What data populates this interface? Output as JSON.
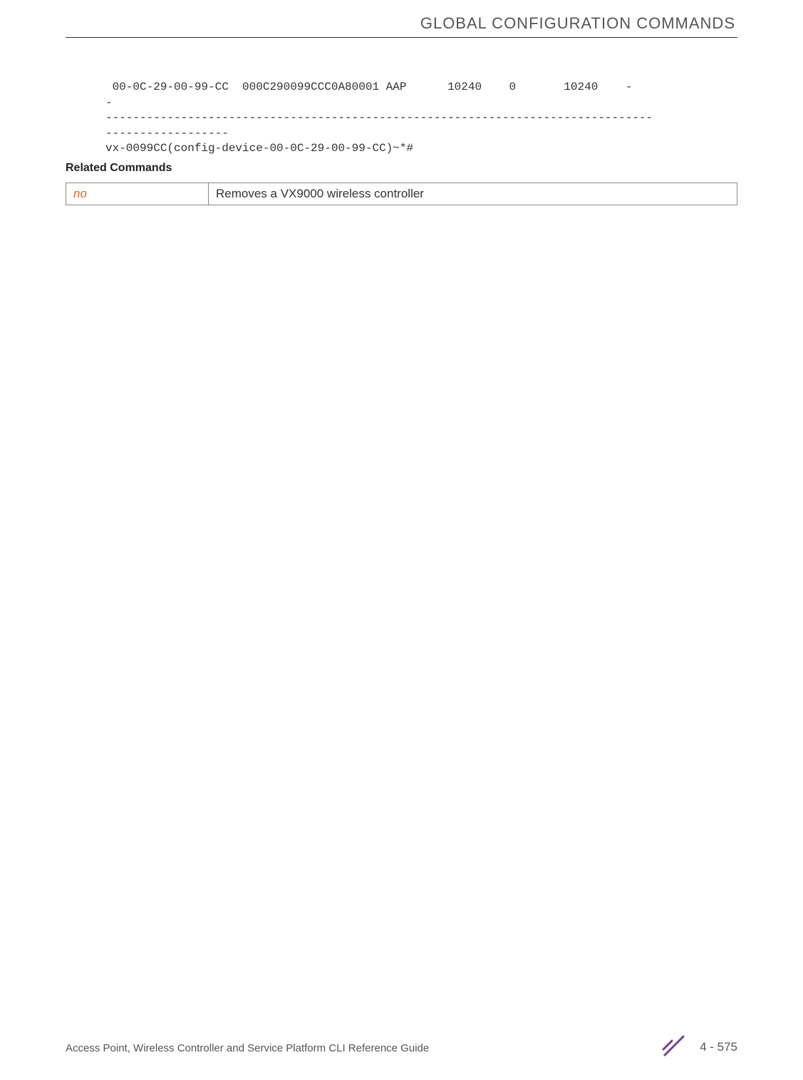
{
  "header": {
    "title": "GLOBAL CONFIGURATION COMMANDS"
  },
  "code": {
    "text": " 00-0C-29-00-99-CC  000C290099CCC0A80001 AAP      10240    0       10240    -       \n-\n--------------------------------------------------------------------------------\n------------------\nvx-0099CC(config-device-00-0C-29-00-99-CC)~*#"
  },
  "related": {
    "heading": "Related Commands",
    "table": {
      "rows": [
        {
          "command": "no",
          "description": "Removes a VX9000 wireless controller"
        }
      ]
    }
  },
  "footer": {
    "text": "Access Point, Wireless Controller and Service Platform CLI Reference Guide",
    "page": "4 - 575"
  }
}
